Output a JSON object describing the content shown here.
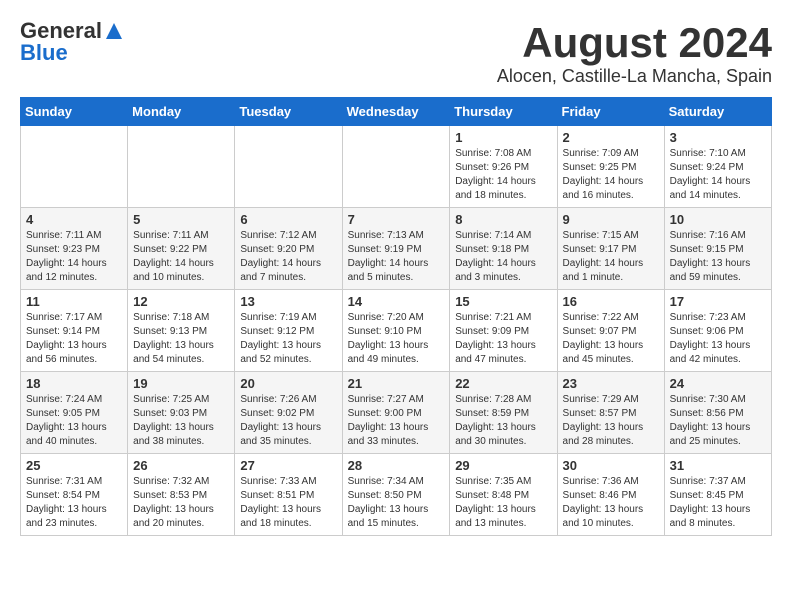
{
  "header": {
    "logo_general": "General",
    "logo_blue": "Blue",
    "month_year": "August 2024",
    "location": "Alocen, Castille-La Mancha, Spain"
  },
  "weekdays": [
    "Sunday",
    "Monday",
    "Tuesday",
    "Wednesday",
    "Thursday",
    "Friday",
    "Saturday"
  ],
  "weeks": [
    [
      {
        "day": "",
        "info": ""
      },
      {
        "day": "",
        "info": ""
      },
      {
        "day": "",
        "info": ""
      },
      {
        "day": "",
        "info": ""
      },
      {
        "day": "1",
        "info": "Sunrise: 7:08 AM\nSunset: 9:26 PM\nDaylight: 14 hours\nand 18 minutes."
      },
      {
        "day": "2",
        "info": "Sunrise: 7:09 AM\nSunset: 9:25 PM\nDaylight: 14 hours\nand 16 minutes."
      },
      {
        "day": "3",
        "info": "Sunrise: 7:10 AM\nSunset: 9:24 PM\nDaylight: 14 hours\nand 14 minutes."
      }
    ],
    [
      {
        "day": "4",
        "info": "Sunrise: 7:11 AM\nSunset: 9:23 PM\nDaylight: 14 hours\nand 12 minutes."
      },
      {
        "day": "5",
        "info": "Sunrise: 7:11 AM\nSunset: 9:22 PM\nDaylight: 14 hours\nand 10 minutes."
      },
      {
        "day": "6",
        "info": "Sunrise: 7:12 AM\nSunset: 9:20 PM\nDaylight: 14 hours\nand 7 minutes."
      },
      {
        "day": "7",
        "info": "Sunrise: 7:13 AM\nSunset: 9:19 PM\nDaylight: 14 hours\nand 5 minutes."
      },
      {
        "day": "8",
        "info": "Sunrise: 7:14 AM\nSunset: 9:18 PM\nDaylight: 14 hours\nand 3 minutes."
      },
      {
        "day": "9",
        "info": "Sunrise: 7:15 AM\nSunset: 9:17 PM\nDaylight: 14 hours\nand 1 minute."
      },
      {
        "day": "10",
        "info": "Sunrise: 7:16 AM\nSunset: 9:15 PM\nDaylight: 13 hours\nand 59 minutes."
      }
    ],
    [
      {
        "day": "11",
        "info": "Sunrise: 7:17 AM\nSunset: 9:14 PM\nDaylight: 13 hours\nand 56 minutes."
      },
      {
        "day": "12",
        "info": "Sunrise: 7:18 AM\nSunset: 9:13 PM\nDaylight: 13 hours\nand 54 minutes."
      },
      {
        "day": "13",
        "info": "Sunrise: 7:19 AM\nSunset: 9:12 PM\nDaylight: 13 hours\nand 52 minutes."
      },
      {
        "day": "14",
        "info": "Sunrise: 7:20 AM\nSunset: 9:10 PM\nDaylight: 13 hours\nand 49 minutes."
      },
      {
        "day": "15",
        "info": "Sunrise: 7:21 AM\nSunset: 9:09 PM\nDaylight: 13 hours\nand 47 minutes."
      },
      {
        "day": "16",
        "info": "Sunrise: 7:22 AM\nSunset: 9:07 PM\nDaylight: 13 hours\nand 45 minutes."
      },
      {
        "day": "17",
        "info": "Sunrise: 7:23 AM\nSunset: 9:06 PM\nDaylight: 13 hours\nand 42 minutes."
      }
    ],
    [
      {
        "day": "18",
        "info": "Sunrise: 7:24 AM\nSunset: 9:05 PM\nDaylight: 13 hours\nand 40 minutes."
      },
      {
        "day": "19",
        "info": "Sunrise: 7:25 AM\nSunset: 9:03 PM\nDaylight: 13 hours\nand 38 minutes."
      },
      {
        "day": "20",
        "info": "Sunrise: 7:26 AM\nSunset: 9:02 PM\nDaylight: 13 hours\nand 35 minutes."
      },
      {
        "day": "21",
        "info": "Sunrise: 7:27 AM\nSunset: 9:00 PM\nDaylight: 13 hours\nand 33 minutes."
      },
      {
        "day": "22",
        "info": "Sunrise: 7:28 AM\nSunset: 8:59 PM\nDaylight: 13 hours\nand 30 minutes."
      },
      {
        "day": "23",
        "info": "Sunrise: 7:29 AM\nSunset: 8:57 PM\nDaylight: 13 hours\nand 28 minutes."
      },
      {
        "day": "24",
        "info": "Sunrise: 7:30 AM\nSunset: 8:56 PM\nDaylight: 13 hours\nand 25 minutes."
      }
    ],
    [
      {
        "day": "25",
        "info": "Sunrise: 7:31 AM\nSunset: 8:54 PM\nDaylight: 13 hours\nand 23 minutes."
      },
      {
        "day": "26",
        "info": "Sunrise: 7:32 AM\nSunset: 8:53 PM\nDaylight: 13 hours\nand 20 minutes."
      },
      {
        "day": "27",
        "info": "Sunrise: 7:33 AM\nSunset: 8:51 PM\nDaylight: 13 hours\nand 18 minutes."
      },
      {
        "day": "28",
        "info": "Sunrise: 7:34 AM\nSunset: 8:50 PM\nDaylight: 13 hours\nand 15 minutes."
      },
      {
        "day": "29",
        "info": "Sunrise: 7:35 AM\nSunset: 8:48 PM\nDaylight: 13 hours\nand 13 minutes."
      },
      {
        "day": "30",
        "info": "Sunrise: 7:36 AM\nSunset: 8:46 PM\nDaylight: 13 hours\nand 10 minutes."
      },
      {
        "day": "31",
        "info": "Sunrise: 7:37 AM\nSunset: 8:45 PM\nDaylight: 13 hours\nand 8 minutes."
      }
    ]
  ]
}
